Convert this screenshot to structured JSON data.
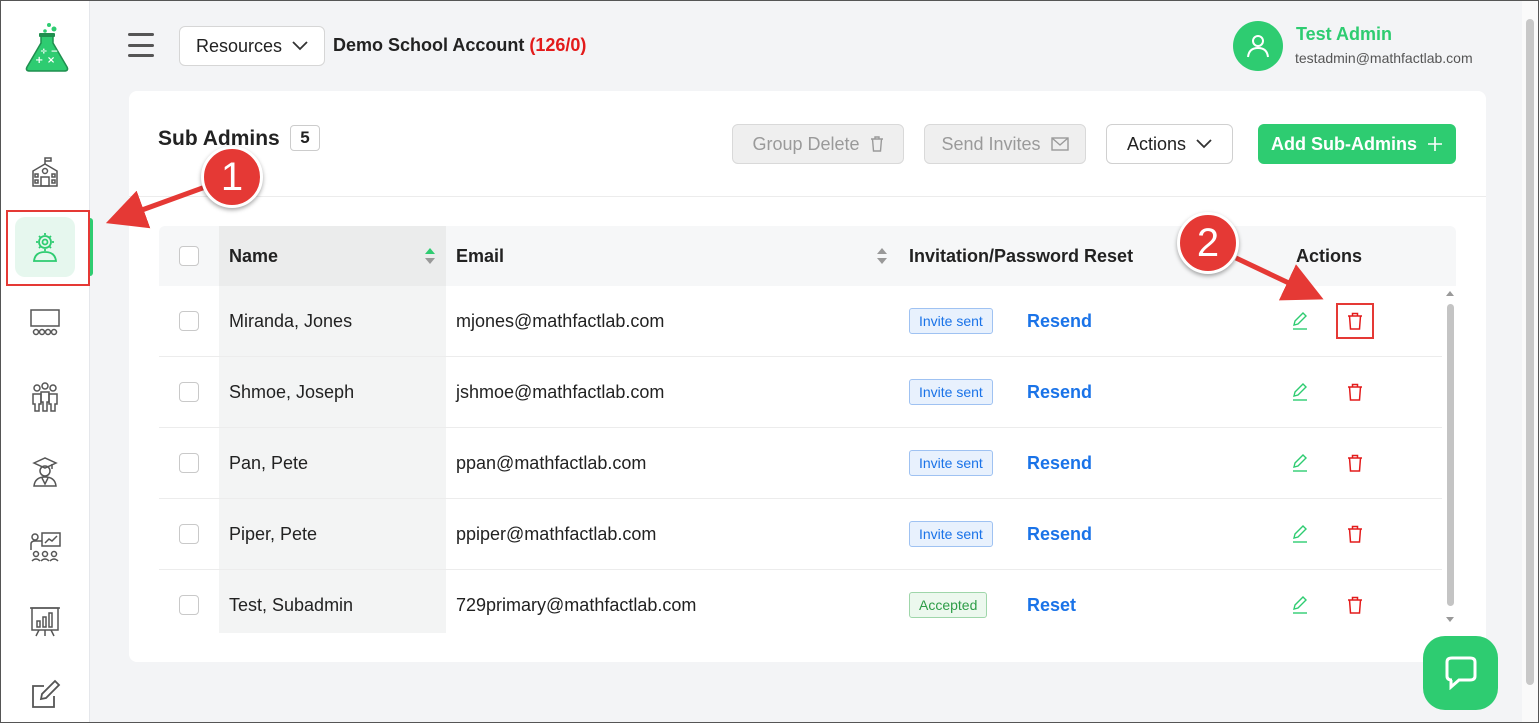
{
  "header": {
    "resources_label": "Resources",
    "account_name": "Demo School Account",
    "account_count": "(126/0)",
    "user_name": "Test Admin",
    "user_email": "testadmin@mathfactlab.com"
  },
  "sidebar": {
    "items": [
      {
        "name": "school",
        "icon": "school-icon"
      },
      {
        "name": "sub-admins",
        "icon": "admin-gear-icon",
        "active": true
      },
      {
        "name": "classes",
        "icon": "classroom-icon"
      },
      {
        "name": "groups",
        "icon": "people-icon"
      },
      {
        "name": "teachers",
        "icon": "graduate-icon"
      },
      {
        "name": "teach",
        "icon": "presenter-icon"
      },
      {
        "name": "reports",
        "icon": "chart-board-icon"
      },
      {
        "name": "edit",
        "icon": "edit-icon"
      }
    ]
  },
  "card": {
    "title": "Sub Admins",
    "count": "5",
    "group_delete_label": "Group Delete",
    "send_invites_label": "Send Invites",
    "actions_label": "Actions",
    "add_label": "Add Sub-Admins"
  },
  "table": {
    "columns": {
      "name": "Name",
      "email": "Email",
      "invitation": "Invitation/Password Reset",
      "actions": "Actions"
    },
    "rows": [
      {
        "name": "Miranda, Jones",
        "email": "mjones@mathfactlab.com",
        "status": "Invite sent",
        "status_type": "sent",
        "link": "Resend"
      },
      {
        "name": "Shmoe, Joseph",
        "email": "jshmoe@mathfactlab.com",
        "status": "Invite sent",
        "status_type": "sent",
        "link": "Resend"
      },
      {
        "name": "Pan, Pete",
        "email": "ppan@mathfactlab.com",
        "status": "Invite sent",
        "status_type": "sent",
        "link": "Resend"
      },
      {
        "name": "Piper, Pete",
        "email": "ppiper@mathfactlab.com",
        "status": "Invite sent",
        "status_type": "sent",
        "link": "Resend"
      },
      {
        "name": "Test, Subadmin",
        "email": "729primary@mathfactlab.com",
        "status": "Accepted",
        "status_type": "ok",
        "link": "Reset"
      }
    ]
  },
  "annotations": {
    "callout_1": "1",
    "callout_2": "2"
  },
  "colors": {
    "brand_green": "#2ecc71",
    "link_blue": "#1a73e8",
    "danger_red": "#e31b1b",
    "annotation_red": "#e53935"
  }
}
